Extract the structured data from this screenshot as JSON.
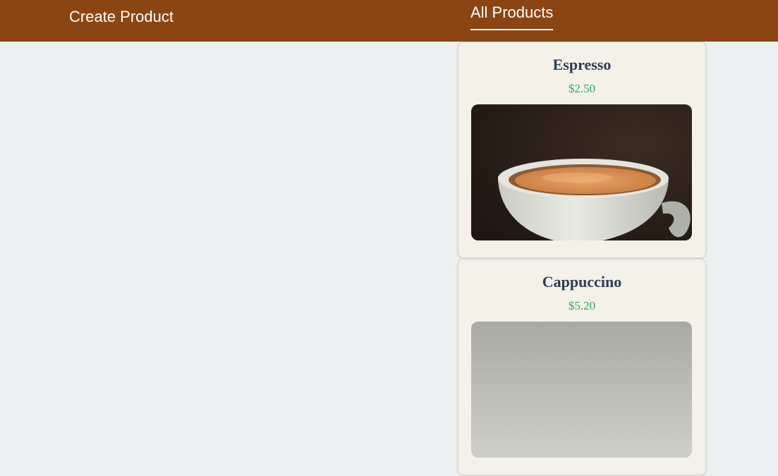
{
  "nav": {
    "create_label": "Create Product",
    "all_label": "All Products"
  },
  "products": [
    {
      "name": "Espresso",
      "price": "$2.50",
      "image": "espresso-cup-photo"
    },
    {
      "name": "Cappuccino",
      "price": "$5.20",
      "image": "cappuccino-photo"
    }
  ],
  "colors": {
    "navbar": "#8b4513",
    "background": "#ecf0f1",
    "card": "#f4f1e9",
    "name": "#2c3e50",
    "price": "#27ae60"
  }
}
